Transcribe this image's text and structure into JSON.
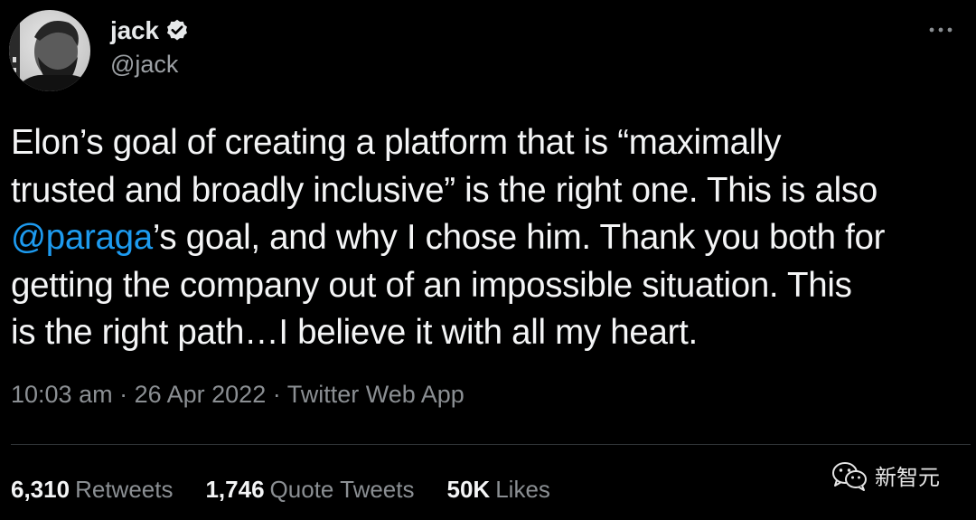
{
  "author": {
    "display_name": "jack",
    "handle": "@jack",
    "verified": true,
    "avatar_icon": "profile-photo"
  },
  "menu": {
    "more_icon": "more-dots-icon"
  },
  "tweet": {
    "lines": [
      "Elon’s goal of creating a platform that is “maximally",
      "trusted and broadly inclusive” is the right one. This is also",
      {
        "mention": "@paraga",
        "rest": "’s goal, and why I chose him. Thank you both for"
      },
      "getting the company out of an impossible situation. This",
      "is the right path…I believe it with all my heart."
    ],
    "line_0": "Elon’s goal of creating a platform that is “maximally",
    "line_1": "trusted and broadly inclusive” is the right one. This is also",
    "line_2_mention": "@paraga",
    "line_2_rest": "’s goal, and why I chose him. Thank you both for",
    "line_3": "getting the company out of an impossible situation. This",
    "line_4": "is the right path…I believe it with all my heart."
  },
  "meta": {
    "time": "10:03 am",
    "separator": " · ",
    "date": "26 Apr 2022",
    "source": "Twitter Web App"
  },
  "stats": {
    "retweets_count": "6,310",
    "retweets_label": "Retweets",
    "quote_count": "1,746",
    "quote_label": "Quote Tweets",
    "likes_count": "50K",
    "likes_label": "Likes"
  },
  "watermark": {
    "icon": "wechat-icon",
    "text": "新智元"
  },
  "colors": {
    "background": "#000000",
    "text": "#f4f5f6",
    "secondary": "#8b8f93",
    "link": "#1d9bf0",
    "divider": "#2f3336"
  }
}
